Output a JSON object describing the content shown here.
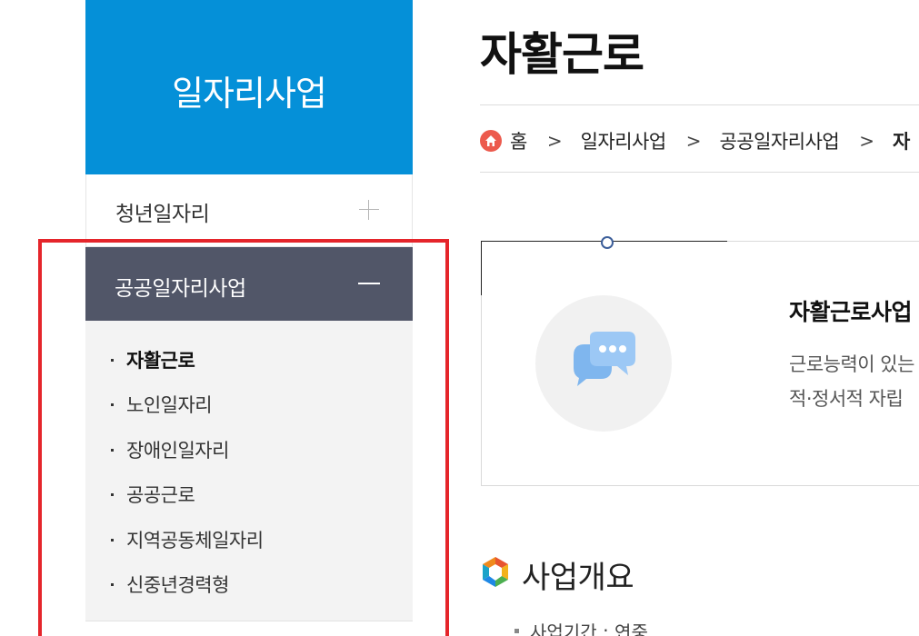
{
  "sidebar": {
    "title": "일자리사업",
    "items": [
      {
        "label": "청년일자리"
      },
      {
        "label": "공공일자리사업"
      }
    ],
    "sub_items": [
      {
        "label": "자활근로"
      },
      {
        "label": "노인일자리"
      },
      {
        "label": "장애인일자리"
      },
      {
        "label": "공공근로"
      },
      {
        "label": "지역공동체일자리"
      },
      {
        "label": "신중년경력형"
      }
    ]
  },
  "main": {
    "page_title": "자활근로",
    "breadcrumb": [
      "홈",
      "일자리사업",
      "공공일자리사업",
      "자"
    ],
    "card": {
      "title": "자활근로사업",
      "desc_line1": "근로능력이 있는",
      "desc_line2": "적·정서적 자립"
    },
    "section_title": "사업개요",
    "overview_items": [
      "사업기간 : 연중"
    ]
  },
  "colors": {
    "sidebar_header": "#0590d8",
    "sidebar_active": "#515668",
    "highlight": "#e5252b",
    "home_icon": "#ec5a4d"
  },
  "icons": [
    "plus-icon",
    "minus-icon",
    "home-icon",
    "chevron-right-icon",
    "chat-bubbles-icon",
    "section-logo-icon"
  ]
}
